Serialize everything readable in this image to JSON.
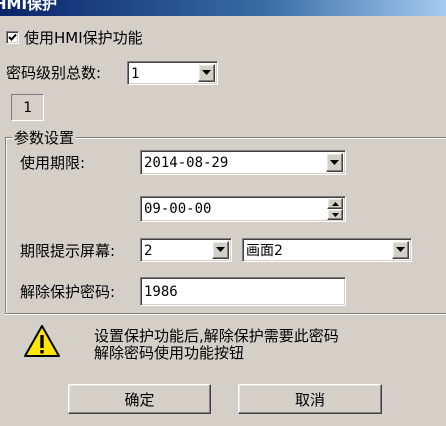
{
  "window": {
    "title": "HMI保护"
  },
  "enable_hmi_protection": {
    "label": "使用HMI保护功能",
    "checked": true
  },
  "password_levels": {
    "label": "密码级别总数:",
    "selected": "1",
    "level_tab": "1"
  },
  "params_group": {
    "title": "参数设置",
    "expiry_label": "使用期限:",
    "expiry_date": "2014-08-29",
    "expiry_time": "09-00-00",
    "reminder_label": "期限提示屏幕:",
    "reminder_screen_no": "2",
    "reminder_screen_name": "画面2",
    "unlock_label": "解除保护密码:",
    "unlock_password": "1986"
  },
  "warning": {
    "icon": "warning-icon",
    "line1": "设置保护功能后,解除保护需要此密码",
    "line2": "解除密码使用功能按钮"
  },
  "buttons": {
    "ok": "确定",
    "cancel": "取消"
  }
}
